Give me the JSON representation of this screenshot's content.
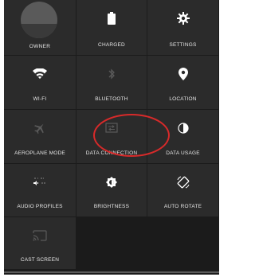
{
  "tiles": {
    "owner": {
      "label": "OWNER",
      "icon": "avatar"
    },
    "charged": {
      "label": "CHARGED",
      "icon": "battery-icon"
    },
    "settings": {
      "label": "SETTINGS",
      "icon": "gear-icon"
    },
    "wifi": {
      "label": "WI-FI",
      "icon": "wifi-icon"
    },
    "bluetooth": {
      "label": "BLUETOOTH",
      "icon": "bluetooth-icon"
    },
    "location": {
      "label": "LOCATION",
      "icon": "location-pin-icon"
    },
    "aeroplane": {
      "label": "AEROPLANE MODE",
      "icon": "airplane-icon"
    },
    "data_connection": {
      "label": "DATA CONNECTION",
      "icon": "data-icon"
    },
    "data_usage": {
      "label": "DATA USAGE",
      "icon": "pie-icon"
    },
    "audio_profiles": {
      "label": "AUDIO PROFILES",
      "icon": "audio-profile-icon"
    },
    "brightness": {
      "label": "BRIGHTNESS",
      "icon": "brightness-icon"
    },
    "auto_rotate": {
      "label": "AUTO ROTATE",
      "icon": "rotate-icon"
    },
    "cast_screen": {
      "label": "CAST SCREEN",
      "icon": "cast-icon"
    }
  },
  "colors": {
    "panel_bg": "#1b1b1b",
    "tile_bg": "#2b2b2b",
    "icon_active": "#ffffff",
    "icon_inactive": "#5a5a5a",
    "annotation_ring": "#d82a2a"
  }
}
